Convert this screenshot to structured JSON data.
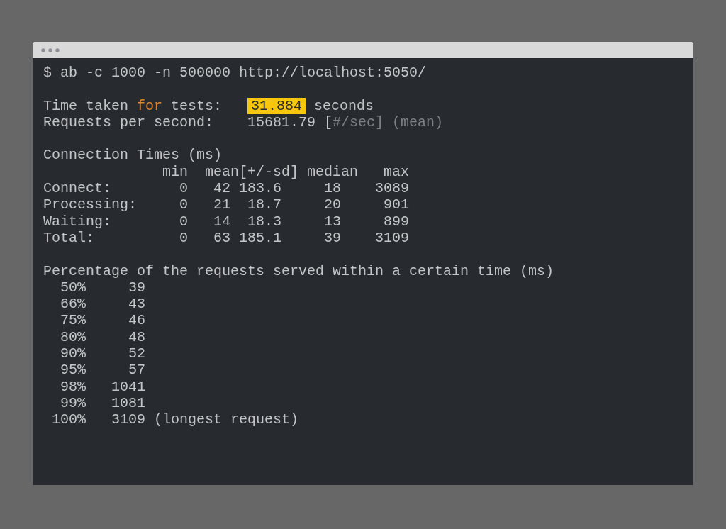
{
  "terminal": {
    "lines": [
      {
        "kind": "text",
        "segments": [
          {
            "kind": "plain",
            "text": "$ ab -c 1000 -n 500000 http://localhost:5050/"
          }
        ]
      },
      {
        "kind": "blank"
      },
      {
        "kind": "text",
        "segments": [
          {
            "kind": "plain",
            "text": "Time taken "
          },
          {
            "kind": "keyword",
            "text": "for"
          },
          {
            "kind": "plain",
            "text": " tests:   "
          },
          {
            "kind": "highlight",
            "text": "31.884"
          },
          {
            "kind": "plain",
            "text": " seconds"
          }
        ]
      },
      {
        "kind": "text",
        "segments": [
          {
            "kind": "plain",
            "text": "Requests per second:    15681.79 ["
          },
          {
            "kind": "dim",
            "text": "#/sec] (mean)"
          }
        ]
      },
      {
        "kind": "blank"
      },
      {
        "kind": "text",
        "segments": [
          {
            "kind": "plain",
            "text": "Connection Times (ms)"
          }
        ]
      },
      {
        "kind": "text",
        "segments": [
          {
            "kind": "plain",
            "text": "              min  mean[+/-sd] median   max"
          }
        ]
      },
      {
        "kind": "text",
        "segments": [
          {
            "kind": "plain",
            "text": "Connect:        0   42 183.6     18    3089"
          }
        ]
      },
      {
        "kind": "text",
        "segments": [
          {
            "kind": "plain",
            "text": "Processing:     0   21  18.7     20     901"
          }
        ]
      },
      {
        "kind": "text",
        "segments": [
          {
            "kind": "plain",
            "text": "Waiting:        0   14  18.3     13     899"
          }
        ]
      },
      {
        "kind": "text",
        "segments": [
          {
            "kind": "plain",
            "text": "Total:          0   63 185.1     39    3109"
          }
        ]
      },
      {
        "kind": "blank"
      },
      {
        "kind": "text",
        "segments": [
          {
            "kind": "plain",
            "text": "Percentage of the requests served within a certain time (ms)"
          }
        ]
      },
      {
        "kind": "text",
        "segments": [
          {
            "kind": "plain",
            "text": "  50%     39"
          }
        ]
      },
      {
        "kind": "text",
        "segments": [
          {
            "kind": "plain",
            "text": "  66%     43"
          }
        ]
      },
      {
        "kind": "text",
        "segments": [
          {
            "kind": "plain",
            "text": "  75%     46"
          }
        ]
      },
      {
        "kind": "text",
        "segments": [
          {
            "kind": "plain",
            "text": "  80%     48"
          }
        ]
      },
      {
        "kind": "text",
        "segments": [
          {
            "kind": "plain",
            "text": "  90%     52"
          }
        ]
      },
      {
        "kind": "text",
        "segments": [
          {
            "kind": "plain",
            "text": "  95%     57"
          }
        ]
      },
      {
        "kind": "text",
        "segments": [
          {
            "kind": "plain",
            "text": "  98%   1041"
          }
        ]
      },
      {
        "kind": "text",
        "segments": [
          {
            "kind": "plain",
            "text": "  99%   1081"
          }
        ]
      },
      {
        "kind": "text",
        "segments": [
          {
            "kind": "plain",
            "text": " 100%   3109 (longest request)"
          }
        ]
      }
    ]
  }
}
